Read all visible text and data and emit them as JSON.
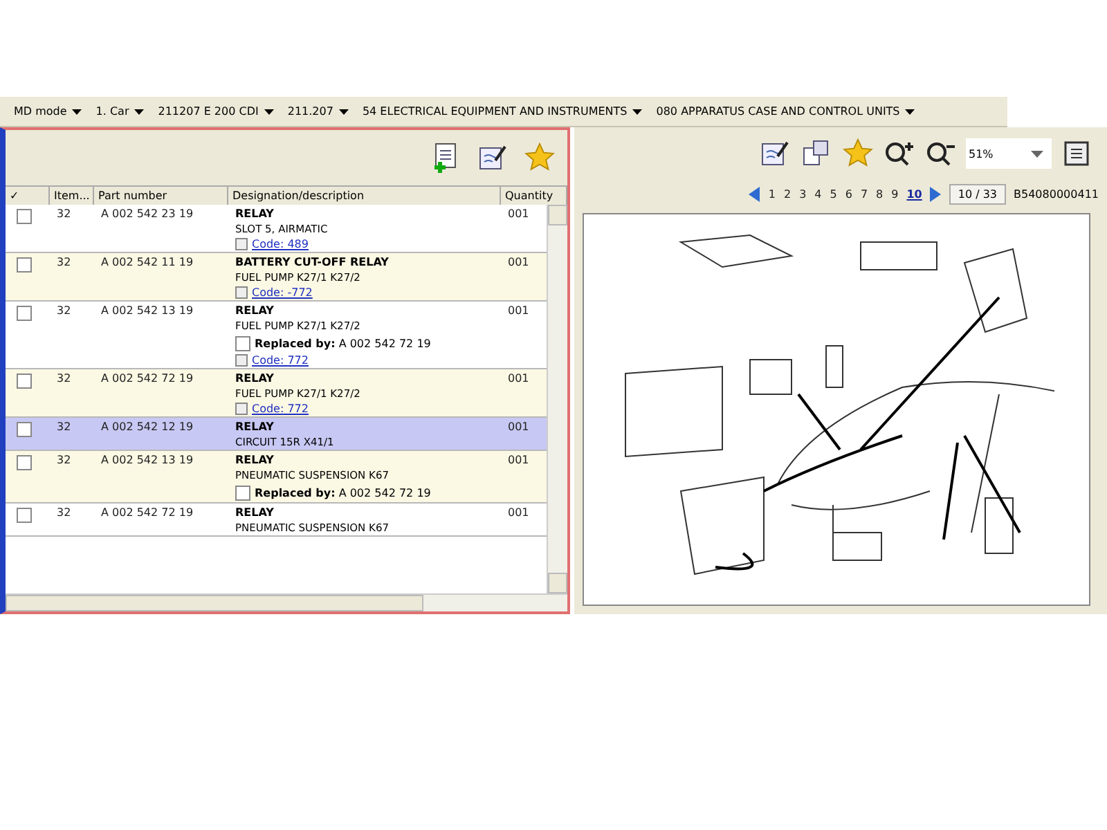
{
  "breadcrumb": [
    {
      "label": "MD mode"
    },
    {
      "label": "1. Car"
    },
    {
      "label": "211207 E 200 CDI"
    },
    {
      "label": "211.207"
    },
    {
      "label": "54 ELECTRICAL EQUIPMENT AND INSTRUMENTS"
    },
    {
      "label": "080 APPARATUS CASE AND CONTROL UNITS"
    }
  ],
  "table": {
    "columns": [
      "✓",
      "Item...",
      "Part number",
      "Designation/description",
      "Quantity"
    ],
    "rows": [
      {
        "checked": false,
        "selected": false,
        "item": "32",
        "part": "A 002 542 23 19",
        "title": "RELAY",
        "desc": "SLOT 5, AIRMATIC",
        "code": "Code: 489",
        "quantity": "001"
      },
      {
        "checked": false,
        "selected": false,
        "item": "32",
        "part": "A 002 542 11 19",
        "title": "BATTERY CUT-OFF RELAY",
        "desc": "FUEL PUMP K27/1 K27/2",
        "code": "Code: -772",
        "quantity": "001"
      },
      {
        "checked": false,
        "selected": false,
        "item": "32",
        "part": "A 002 542 13 19",
        "title": "RELAY",
        "desc": "FUEL PUMP K27/1 K27/2",
        "replaced": "**Replaced by:** A 002 542 72 19",
        "code": "Code: 772",
        "quantity": "001"
      },
      {
        "checked": false,
        "selected": false,
        "item": "32",
        "part": "A 002 542 72 19",
        "title": "RELAY",
        "desc": "FUEL PUMP K27/1 K27/2",
        "code": "Code: 772",
        "quantity": "001"
      },
      {
        "checked": false,
        "selected": true,
        "item": "32",
        "part": "A 002 542 12 19",
        "title": "RELAY",
        "desc": "CIRCUIT 15R X41/1",
        "quantity": "001"
      },
      {
        "checked": false,
        "selected": false,
        "item": "32",
        "part": "A 002 542 13 19",
        "title": "RELAY",
        "desc": "PNEUMATIC SUSPENSION K67",
        "replaced": "**Replaced by:** A 002 542 72 19",
        "quantity": "001"
      },
      {
        "checked": false,
        "selected": false,
        "item": "32",
        "part": "A 002 542 72 19",
        "title": "RELAY",
        "desc": "PNEUMATIC SUSPENSION K67",
        "quantity": "001"
      }
    ]
  },
  "viewer": {
    "zoom": "51%",
    "pages": [
      {
        "label": "1",
        "selected": false
      },
      {
        "label": "2",
        "selected": false
      },
      {
        "label": "3",
        "selected": false
      },
      {
        "label": "4",
        "selected": false
      },
      {
        "label": "5",
        "selected": false
      },
      {
        "label": "6",
        "selected": false
      },
      {
        "label": "7",
        "selected": false
      },
      {
        "label": "8",
        "selected": false
      },
      {
        "label": "9",
        "selected": false
      },
      {
        "label": "10",
        "selected": true
      }
    ],
    "page_field": "10 / 33",
    "drawing_code": "B54080000411"
  }
}
